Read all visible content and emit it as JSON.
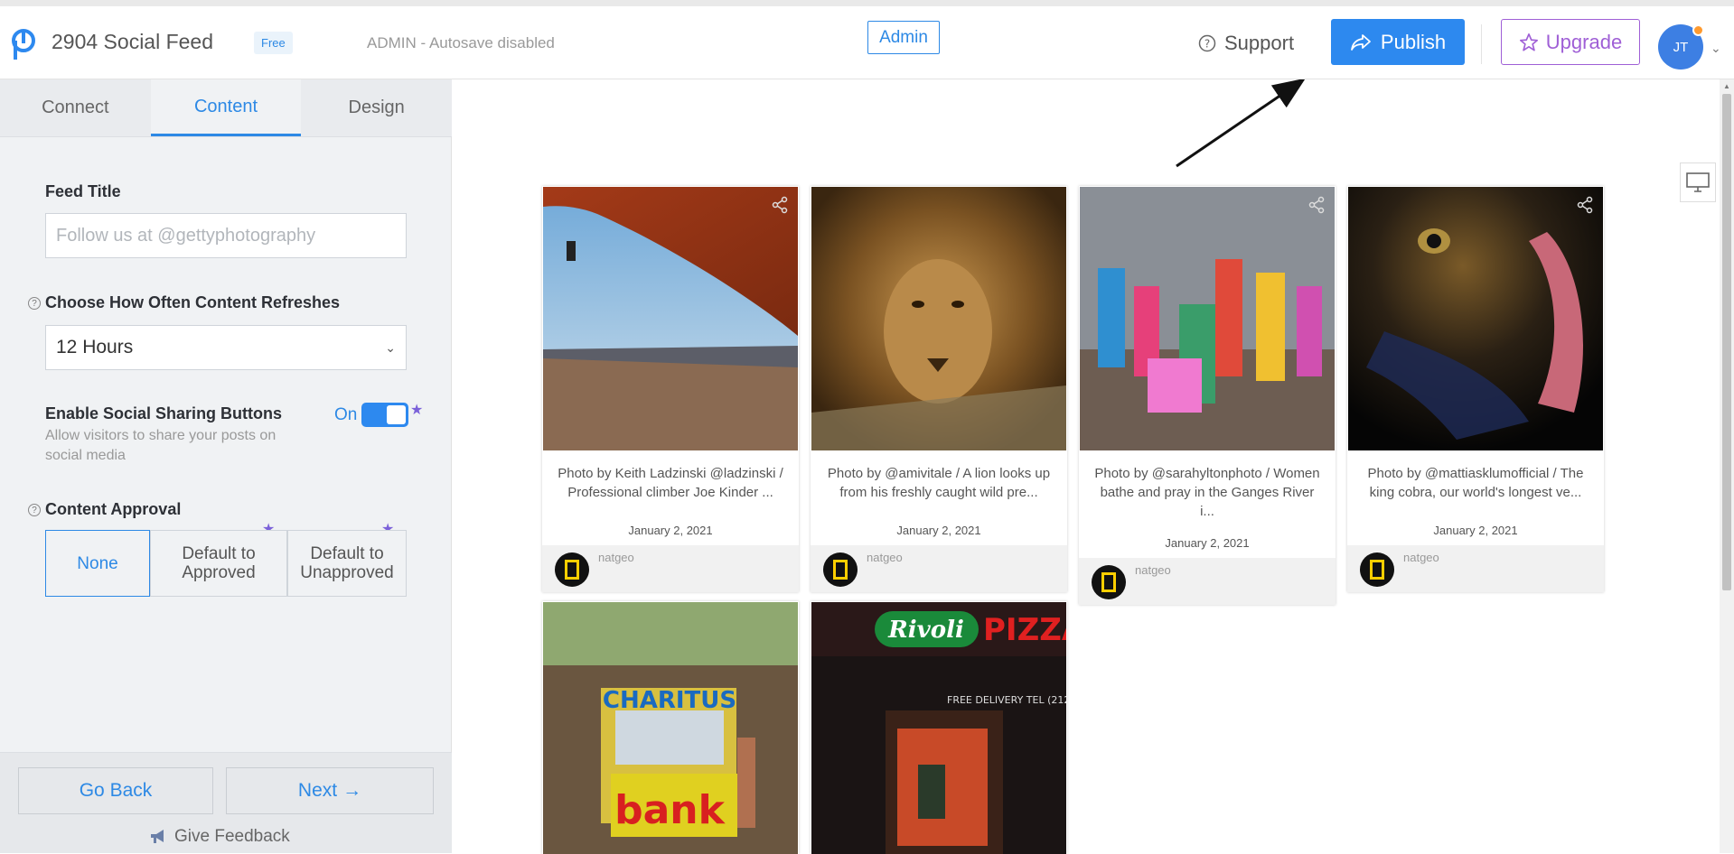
{
  "header": {
    "app_title": "2904 Social Feed",
    "plan_badge": "Free",
    "admin_status": "ADMIN - Autosave disabled",
    "admin_button": "Admin",
    "support": "Support",
    "publish": "Publish",
    "upgrade": "Upgrade",
    "avatar_initials": "JT"
  },
  "sidebar": {
    "tabs": [
      {
        "label": "Connect"
      },
      {
        "label": "Content"
      },
      {
        "label": "Design"
      }
    ],
    "feed_title": {
      "label": "Feed Title",
      "placeholder": "Follow us at @gettyphotography",
      "value": ""
    },
    "refresh": {
      "label": "Choose How Often Content Refreshes",
      "value": "12 Hours"
    },
    "sharing": {
      "label": "Enable Social Sharing Buttons",
      "helper": "Allow visitors to share your posts on social media",
      "state": "On"
    },
    "approval": {
      "label": "Content Approval",
      "options": [
        "None",
        "Default to Approved",
        "Default to Unapproved"
      ],
      "selected": "None"
    },
    "go_back": "Go Back",
    "next": "Next",
    "feedback": "Give Feedback"
  },
  "colors": {
    "accent": "#2d89ef",
    "upgrade": "#9f5fd6",
    "star": "#7b61d9"
  },
  "posts": [
    {
      "caption": "Photo by Keith Ladzinski @ladzinski / Professional climber Joe Kinder ...",
      "date": "January 2, 2021",
      "author": "natgeo"
    },
    {
      "caption": "Photo by @amivitale / A lion looks up from his freshly caught wild pre...",
      "date": "January 2, 2021",
      "author": "natgeo"
    },
    {
      "caption": "Photo by @sarahyltonphoto / Women bathe and pray in the Ganges River i...",
      "date": "January 2, 2021",
      "author": "natgeo"
    },
    {
      "caption": "Photo by @mattiasklumofficial / The king cobra, our world's longest ve...",
      "date": "January 2, 2021",
      "author": "natgeo"
    }
  ],
  "image_signs": {
    "bank_sign_top": "CHARITUS",
    "bank_sign_bottom": "bank",
    "pizza_sign": "Rivoli",
    "pizza_word": "PIZZA",
    "delivery": "FREE DELIVERY   TEL (212"
  }
}
